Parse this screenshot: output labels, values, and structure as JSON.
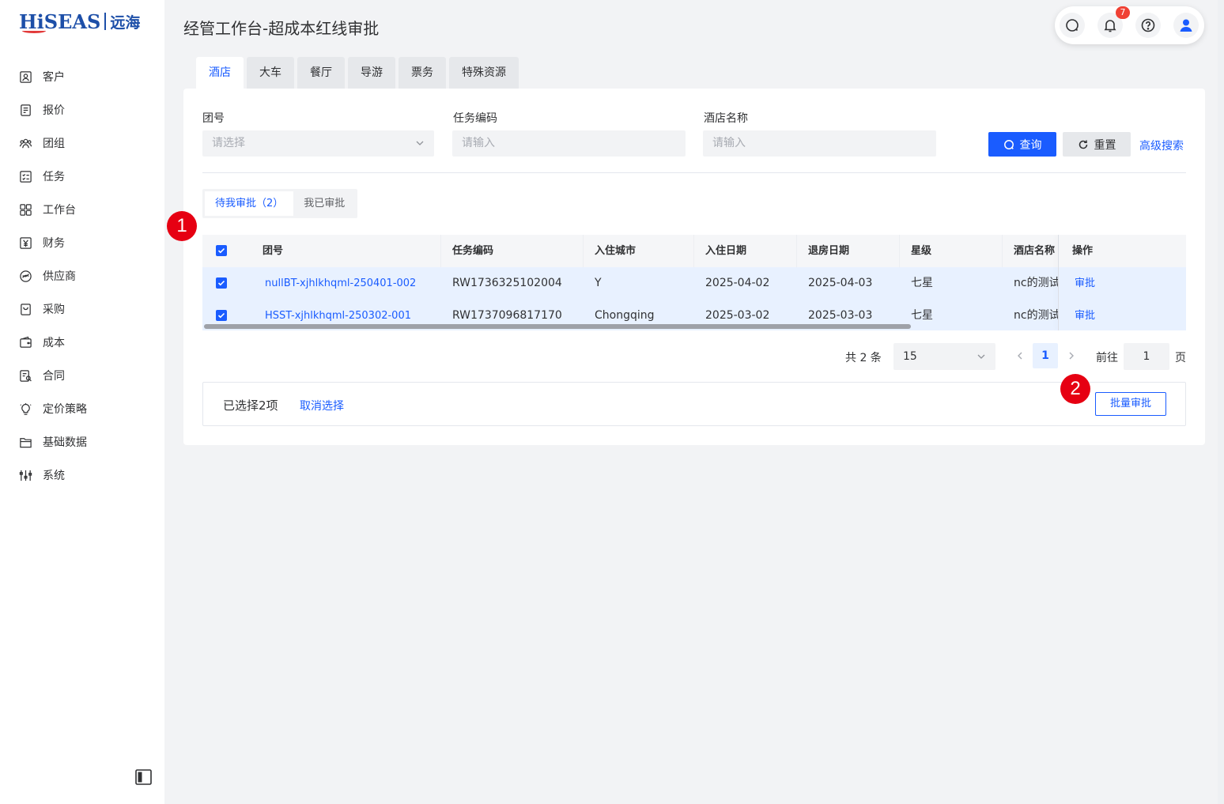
{
  "app": {
    "logo_brand": "HiSEAS",
    "logo_cn": "远海"
  },
  "sidebar": {
    "items": [
      {
        "label": "客户",
        "icon": "customer-icon"
      },
      {
        "label": "报价",
        "icon": "quote-icon"
      },
      {
        "label": "团组",
        "icon": "group-icon"
      },
      {
        "label": "任务",
        "icon": "task-icon"
      },
      {
        "label": "工作台",
        "icon": "workbench-icon"
      },
      {
        "label": "财务",
        "icon": "finance-icon"
      },
      {
        "label": "供应商",
        "icon": "supplier-icon"
      },
      {
        "label": "采购",
        "icon": "purchase-icon"
      },
      {
        "label": "成本",
        "icon": "cost-icon"
      },
      {
        "label": "合同",
        "icon": "contract-icon"
      },
      {
        "label": "定价策略",
        "icon": "pricing-icon"
      },
      {
        "label": "基础数据",
        "icon": "base-data-icon"
      },
      {
        "label": "系统",
        "icon": "system-icon"
      }
    ]
  },
  "header": {
    "title": "经管工作台-超成本红线审批",
    "notification_count": "7"
  },
  "tabs": [
    "酒店",
    "大车",
    "餐厅",
    "导游",
    "票务",
    "特殊资源"
  ],
  "filters": {
    "group_no": {
      "label": "团号",
      "placeholder": "请选择"
    },
    "task_code": {
      "label": "任务编码",
      "placeholder": "请输入"
    },
    "hotel_name": {
      "label": "酒店名称",
      "placeholder": "请输入"
    },
    "query_label": "查询",
    "reset_label": "重置",
    "advanced_label": "高级搜索"
  },
  "subtabs": {
    "pending": "待我审批（2）",
    "done": "我已审批"
  },
  "table": {
    "columns": [
      "团号",
      "任务编码",
      "入住城市",
      "入住日期",
      "退房日期",
      "星级",
      "酒店名称",
      "操作"
    ],
    "rows": [
      {
        "group_no": "nullBT-xjhlkhqml-250401-002",
        "task_code": "RW1736325102004",
        "city": "Y",
        "checkin": "2025-04-02",
        "checkout": "2025-04-03",
        "star": "七星",
        "hotel": "nc的测试",
        "action": "审批"
      },
      {
        "group_no": "HSST-xjhlkhqml-250302-001",
        "task_code": "RW1737096817170",
        "city": "Chongqing",
        "checkin": "2025-03-02",
        "checkout": "2025-03-03",
        "star": "七星",
        "hotel": "nc的测试",
        "action": "审批"
      }
    ]
  },
  "pagination": {
    "total": "共 2 条",
    "page_size": "15",
    "current": "1",
    "goto_label": "前往",
    "goto_value": "1",
    "page_suffix": "页"
  },
  "selection": {
    "count_text": "已选择2项",
    "cancel_label": "取消选择",
    "batch_label": "批量审批"
  },
  "markers": [
    "1",
    "2"
  ],
  "colors": {
    "primary": "#1a5cff",
    "marker": "#e60012",
    "row_selected": "#e8f1ff"
  }
}
